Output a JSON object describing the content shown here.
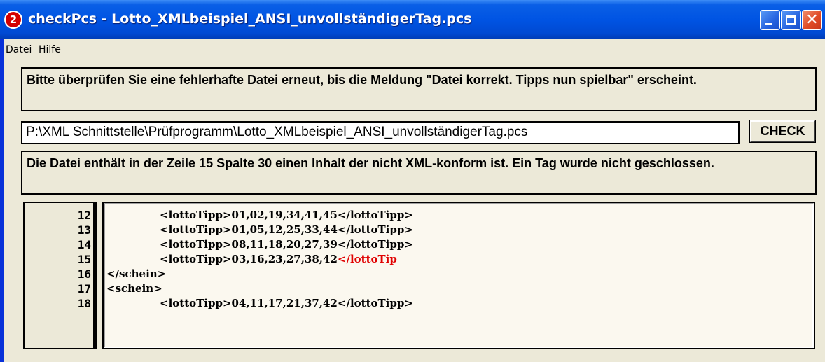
{
  "window": {
    "title": "checkPcs - Lotto_XMLbeispiel_ANSI_unvollständigerTag.pcs",
    "app_icon_glyph": "2",
    "close_glyph": "✕"
  },
  "menu": {
    "datei": "Datei",
    "hilfe": "Hilfe"
  },
  "info_message": "Bitte überprüfen Sie eine fehlerhafte Datei erneut, bis die Meldung \"Datei korrekt. Tipps nun spielbar\" erscheint.",
  "file_path": "P:\\XML Schnittstelle\\Prüfprogramm\\Lotto_XMLbeispiel_ANSI_unvollständigerTag.pcs",
  "check_button": "CHECK",
  "error_message": "Die Datei enthält in der Zeile 15 Spalte 30 einen Inhalt der nicht XML-konform ist. Ein Tag wurde nicht geschlossen.",
  "code_lines": [
    {
      "number": "12",
      "indent": true,
      "text": "<lottoTipp>01,02,19,34,41,45</lottoTipp>",
      "error_text": ""
    },
    {
      "number": "13",
      "indent": true,
      "text": "<lottoTipp>01,05,12,25,33,44</lottoTipp>",
      "error_text": ""
    },
    {
      "number": "14",
      "indent": true,
      "text": "<lottoTipp>08,11,18,20,27,39</lottoTipp>",
      "error_text": ""
    },
    {
      "number": "15",
      "indent": true,
      "text": "<lottoTipp>03,16,23,27,38,42",
      "error_text": "</lottoTip"
    },
    {
      "number": "16",
      "indent": false,
      "text": "</schein>",
      "error_text": ""
    },
    {
      "number": "17",
      "indent": false,
      "text": "<schein>",
      "error_text": ""
    },
    {
      "number": "18",
      "indent": true,
      "text": "<lottoTipp>04,11,17,21,37,42</lottoTipp>",
      "error_text": ""
    }
  ],
  "colors": {
    "titlebar": "#0054e3",
    "error_highlight": "#e00000",
    "window_bg": "#ece9d8"
  }
}
